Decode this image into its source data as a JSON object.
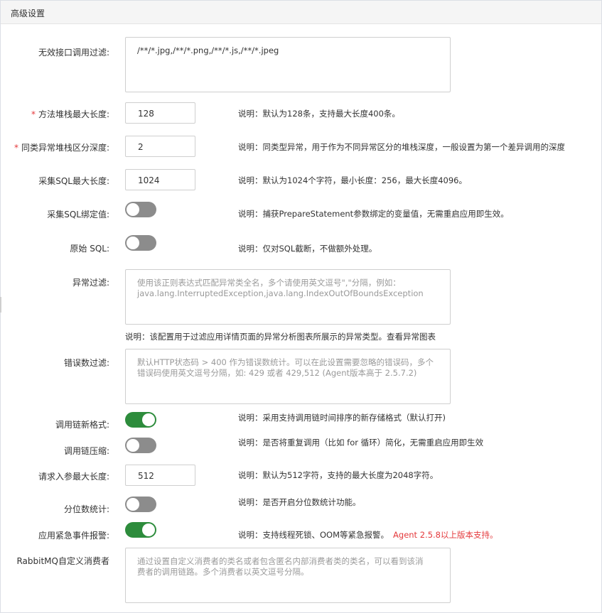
{
  "header": {
    "title": "高级设置"
  },
  "fields": {
    "invalid_api_filter": {
      "label": "无效接口调用过滤:",
      "value": "/**/*.jpg,/**/*.png,/**/*.js,/**/*.jpeg"
    },
    "method_stack_max_length": {
      "required_mark": "*",
      "label": "方法堆栈最大长度:",
      "value": "128",
      "description": "说明：默认为128条，支持最大长度400条。"
    },
    "same_exception_stack_depth": {
      "required_mark": "*",
      "label": "同类异常堆栈区分深度:",
      "value": "2",
      "description": "说明：同类型异常，用于作为不同异常区分的堆栈深度，一般设置为第一个差异调用的深度"
    },
    "sql_max_length": {
      "label": "采集SQL最大长度:",
      "value": "1024",
      "description": "说明：默认为1024个字符，最小长度：256，最大长度4096。"
    },
    "sql_binding_values": {
      "label": "采集SQL绑定值:",
      "enabled": false,
      "description": "说明：捕获PrepareStatement参数绑定的变量值，无需重启应用即生效。"
    },
    "raw_sql": {
      "label": "原始 SQL:",
      "enabled": false,
      "description": "说明：仅对SQL截断，不做额外处理。"
    },
    "exception_filter": {
      "label": "异常过滤:",
      "placeholder": "使用该正则表达式匹配异常类全名，多个请使用英文逗号\",\"分隔，例如：java.lang.InterruptedException,java.lang.IndexOutOfBoundsException",
      "placeholder_line1": "使用该正则表达式匹配异常类全名，多个请使用英文逗号\",\"分隔，例如：",
      "placeholder_line2": "java.lang.InterruptedException,java.lang.IndexOutOfBoundsException",
      "description": "说明：该配置用于过滤应用详情页面的异常分析图表所展示的异常类型。查看异常图表"
    },
    "error_count_filter": {
      "label": "错误数过滤:",
      "placeholder_line1": "默认HTTP状态码 > 400 作为错误数统计。可以在此设置需要忽略的错误码，多个",
      "placeholder_line2": "错误码使用英文逗号分隔，如: 429 或者 429,512 (Agent版本高于 2.5.7.2)"
    },
    "trace_new_format": {
      "label": "调用链新格式:",
      "enabled": true,
      "description": "说明：采用支持调用链时间排序的新存储格式（默认打开)"
    },
    "trace_compression": {
      "label": "调用链压缩:",
      "enabled": false,
      "description": "说明：是否将重复调用（比如 for 循环）简化，无需重启应用即生效"
    },
    "request_param_max_length": {
      "label": "请求入参最大长度:",
      "value": "512",
      "description": "说明：默认为512字符，支持的最大长度为2048字符。"
    },
    "percentile_stats": {
      "label": "分位数统计:",
      "enabled": false,
      "description": "说明：是否开启分位数统计功能。"
    },
    "emergency_alert": {
      "label": "应用紧急事件报警:",
      "enabled": true,
      "description": "说明：支持线程死锁、OOM等紧急报警。",
      "version_note": "Agent 2.5.8以上版本支持。"
    },
    "rabbitmq_consumer": {
      "label": "RabbitMQ自定义消费者",
      "placeholder_line1": "通过设置自定义消费者的类名或者包含匿名内部消费者类的类名，可以看到该消",
      "placeholder_line2": "费者的调用链路。多个消费者以英文逗号分隔。"
    }
  },
  "colors": {
    "toggle_on": "#2d8c3c",
    "toggle_off": "#8c8c8c",
    "required": "#e4393c",
    "version_note": "#e4393c"
  }
}
